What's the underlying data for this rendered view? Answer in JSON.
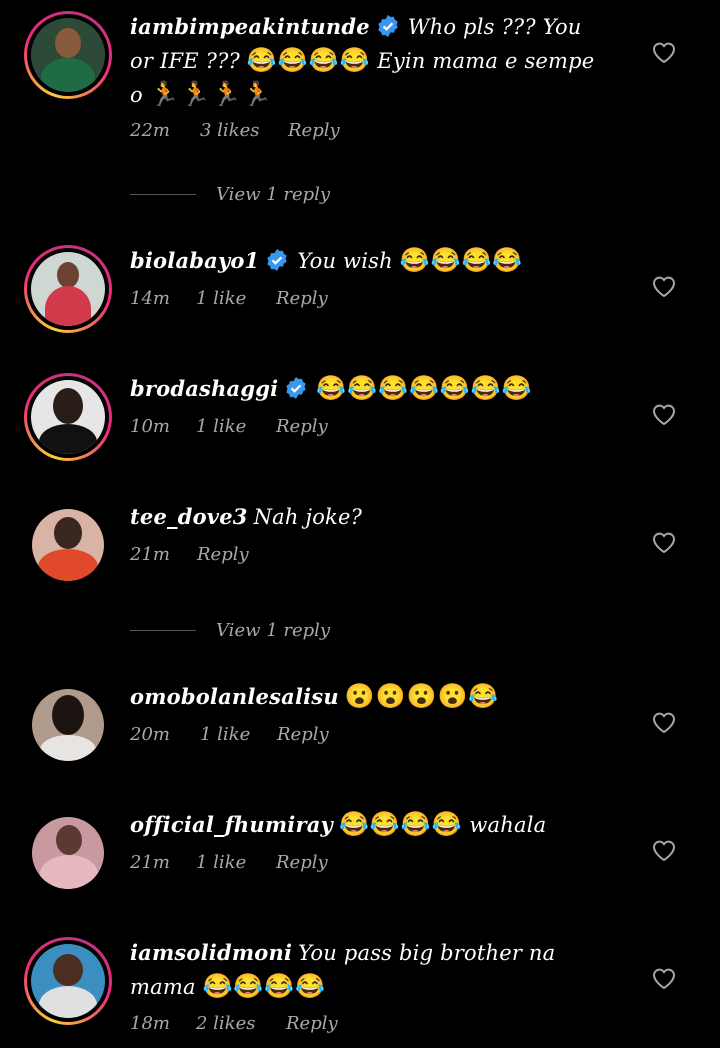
{
  "comments": [
    {
      "username": "iambimpeakintunde",
      "verified": true,
      "text": "Who pls ??? You or IFE ??? ",
      "emoji": "😂😂😂😂",
      "text2": " Eyin mama e sempe o ",
      "emoji2": "🏃🏃🏃🏃",
      "time": "22m",
      "likes": "3 likes",
      "reply": "Reply",
      "view_replies": "View 1 reply"
    },
    {
      "username": "biolabayo1",
      "verified": true,
      "text": "You wish ",
      "emoji": "😂😂😂😂",
      "time": "14m",
      "likes": "1 like",
      "reply": "Reply"
    },
    {
      "username": "brodashaggi",
      "verified": true,
      "text": "",
      "emoji": "😂😂😂😂😂😂😂",
      "time": "10m",
      "likes": "1 like",
      "reply": "Reply"
    },
    {
      "username": "tee_dove3",
      "verified": false,
      "text": "Nah joke?",
      "emoji": "",
      "time": "21m",
      "likes": "",
      "reply": "Reply",
      "view_replies": "View 1 reply"
    },
    {
      "username": "omobolanlesalisu",
      "verified": false,
      "text": "",
      "emoji": "😮😮😮😮😂",
      "time": "20m",
      "likes": "1 like",
      "reply": "Reply"
    },
    {
      "username": "official_fhumiray",
      "verified": false,
      "text": "",
      "emoji": "😂😂😂😂",
      "text2": " wahala",
      "time": "21m",
      "likes": "1 like",
      "reply": "Reply"
    },
    {
      "username": "iamsolidmoni",
      "verified": false,
      "text": "You pass big brother na mama ",
      "emoji": "😂😂😂😂",
      "time": "18m",
      "likes": "2 likes",
      "reply": "Reply"
    }
  ],
  "colors": {
    "background": "#000000",
    "meta": "#a8a8a8",
    "verified": "#3897f0"
  },
  "icons": {
    "heart": "heart-outline-icon",
    "verified": "verified-badge-icon"
  }
}
